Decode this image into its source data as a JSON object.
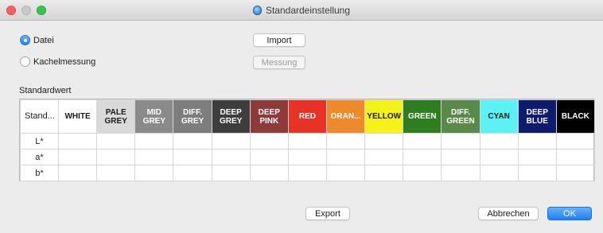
{
  "window": {
    "title": "Standardeinstellung"
  },
  "source": {
    "options": [
      {
        "label": "Datei",
        "selected": true
      },
      {
        "label": "Kachelmessung",
        "selected": false
      }
    ],
    "import_label": "Import",
    "measure_label": "Messung"
  },
  "standard": {
    "section_label": "Standardwert",
    "first_header": "Stand...",
    "columns": [
      {
        "label": "WHITE",
        "bg": "#ffffff",
        "fg": "#1a1a1a"
      },
      {
        "label": "PALE GREY",
        "bg": "#d9d9d9",
        "fg": "#1a1a1a"
      },
      {
        "label": "MID GREY",
        "bg": "#8a8a8a",
        "fg": "#ffffff"
      },
      {
        "label": "DIFF. GREY",
        "bg": "#7d7d7d",
        "fg": "#ffffff"
      },
      {
        "label": "DEEP GREY",
        "bg": "#3d3d3d",
        "fg": "#ffffff"
      },
      {
        "label": "DEEP PINK",
        "bg": "#8f3a3a",
        "fg": "#ffffff"
      },
      {
        "label": "RED",
        "bg": "#e83228",
        "fg": "#ffffff"
      },
      {
        "label": "ORAN...",
        "bg": "#ee8a2c",
        "fg": "#ffffff"
      },
      {
        "label": "YELLOW",
        "bg": "#f5f21a",
        "fg": "#1a1a1a"
      },
      {
        "label": "GREEN",
        "bg": "#2e7d1f",
        "fg": "#ffffff"
      },
      {
        "label": "DIFF. GREEN",
        "bg": "#5a8a4a",
        "fg": "#ffffff"
      },
      {
        "label": "CYAN",
        "bg": "#5cf2f5",
        "fg": "#1a1a1a"
      },
      {
        "label": "DEEP BLUE",
        "bg": "#0d1a6e",
        "fg": "#ffffff"
      },
      {
        "label": "BLACK",
        "bg": "#000000",
        "fg": "#ffffff"
      }
    ],
    "rows": [
      "L*",
      "a*",
      "b*"
    ]
  },
  "footer": {
    "export_label": "Export",
    "cancel_label": "Abbrechen",
    "ok_label": "OK"
  }
}
